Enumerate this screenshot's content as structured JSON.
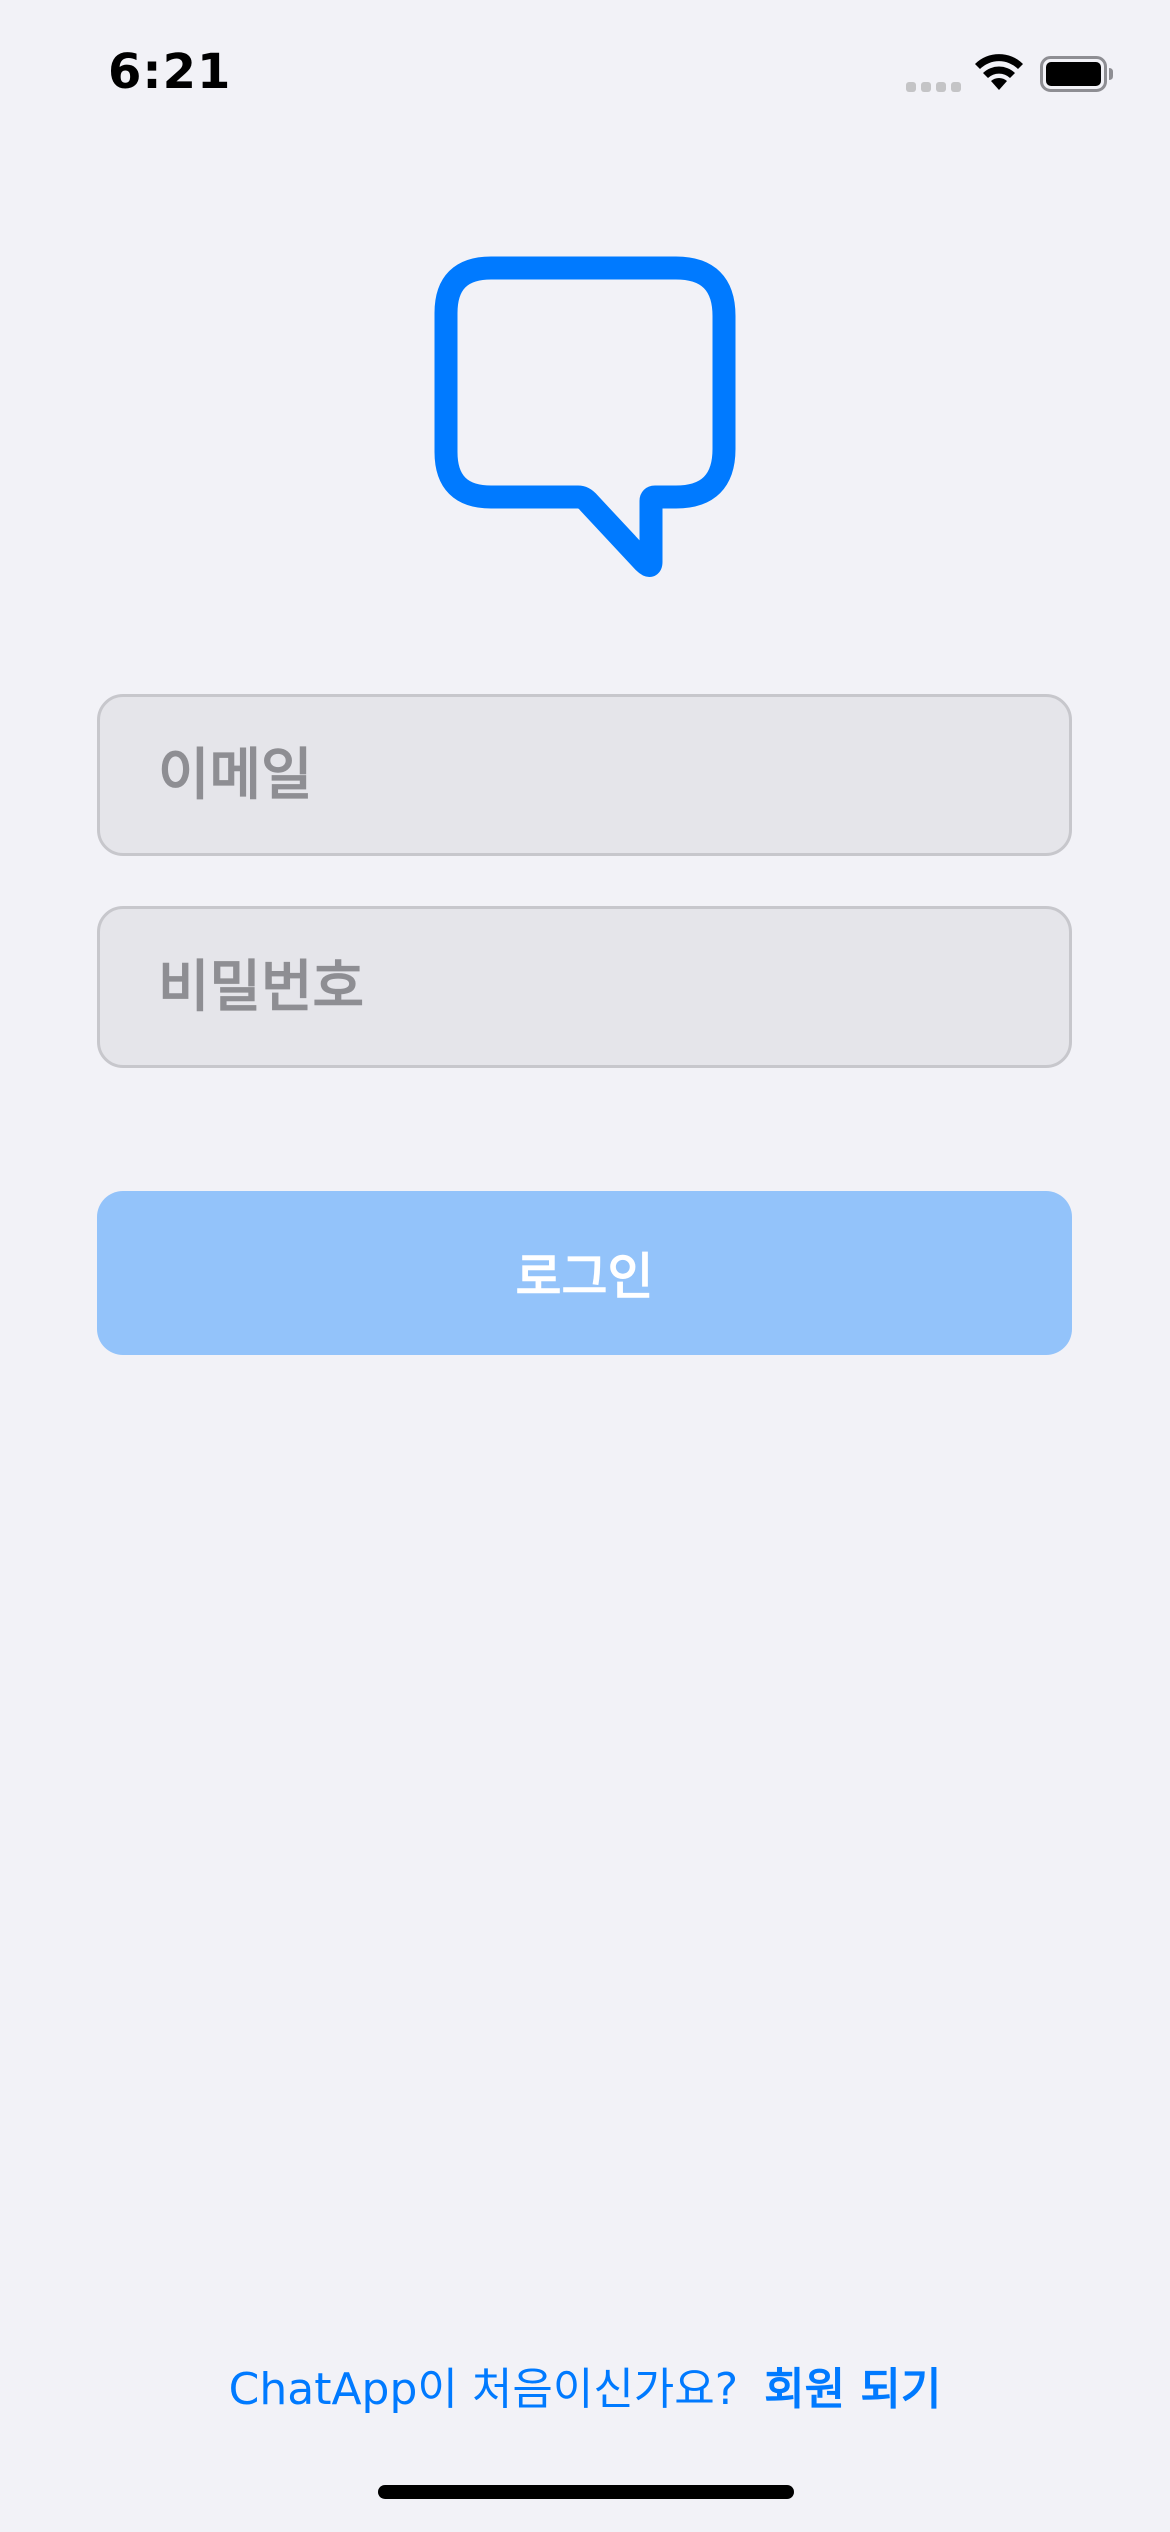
{
  "status_bar": {
    "time": "6:21"
  },
  "icons": {
    "logo": "chat-bubble-icon",
    "signal": "cellular-signal-icon",
    "wifi": "wifi-icon",
    "battery": "battery-icon"
  },
  "colors": {
    "accent": "#007aff",
    "background": "#f2f2f7",
    "field_background": "#e5e5ea",
    "field_border": "#c7c7cc",
    "placeholder": "#8e8e93",
    "button_disabled": "#93c3fa"
  },
  "form": {
    "email_placeholder": "이메일",
    "email_value": "",
    "password_placeholder": "비밀번호",
    "password_value": "",
    "login_label": "로그인"
  },
  "footer": {
    "prompt": "ChatApp이 처음이신가요?",
    "signup_label": "회원 되기"
  }
}
